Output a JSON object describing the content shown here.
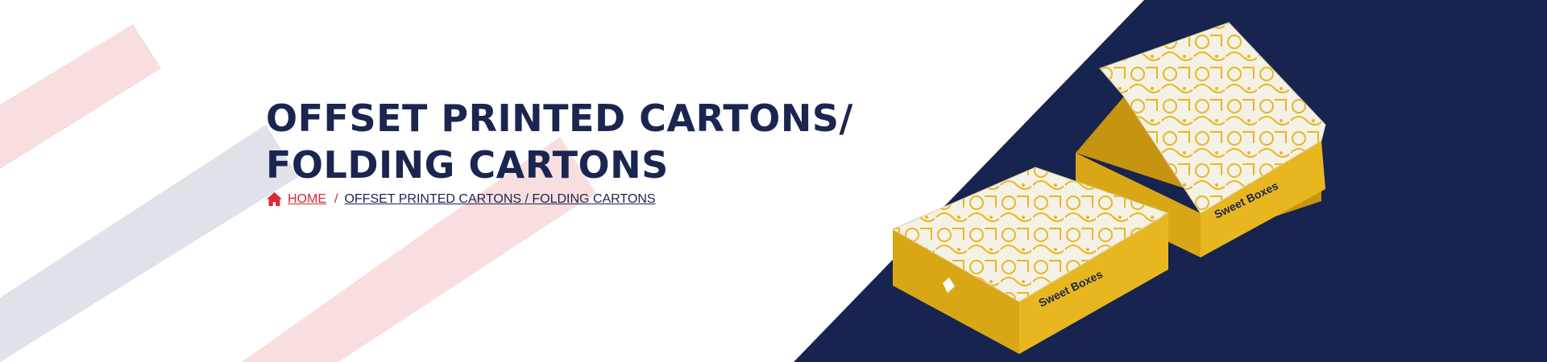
{
  "page": {
    "title_line1": "OFFSET PRINTED CARTONS/",
    "title_line2": "FOLDING CARTONS"
  },
  "breadcrumb": {
    "home_label": "HOME",
    "separator": "/",
    "current_label": "OFFSET PRINTED CARTONS / FOLDING CARTONS"
  },
  "product_image": {
    "box_label_front": "Sweet Boxes",
    "box_label_back": "Sweet Boxes"
  },
  "colors": {
    "navy": "#1a2550",
    "accent_red": "#e0272e",
    "box_yellow": "#e8b71f"
  },
  "icons": {
    "home": "home-icon"
  }
}
